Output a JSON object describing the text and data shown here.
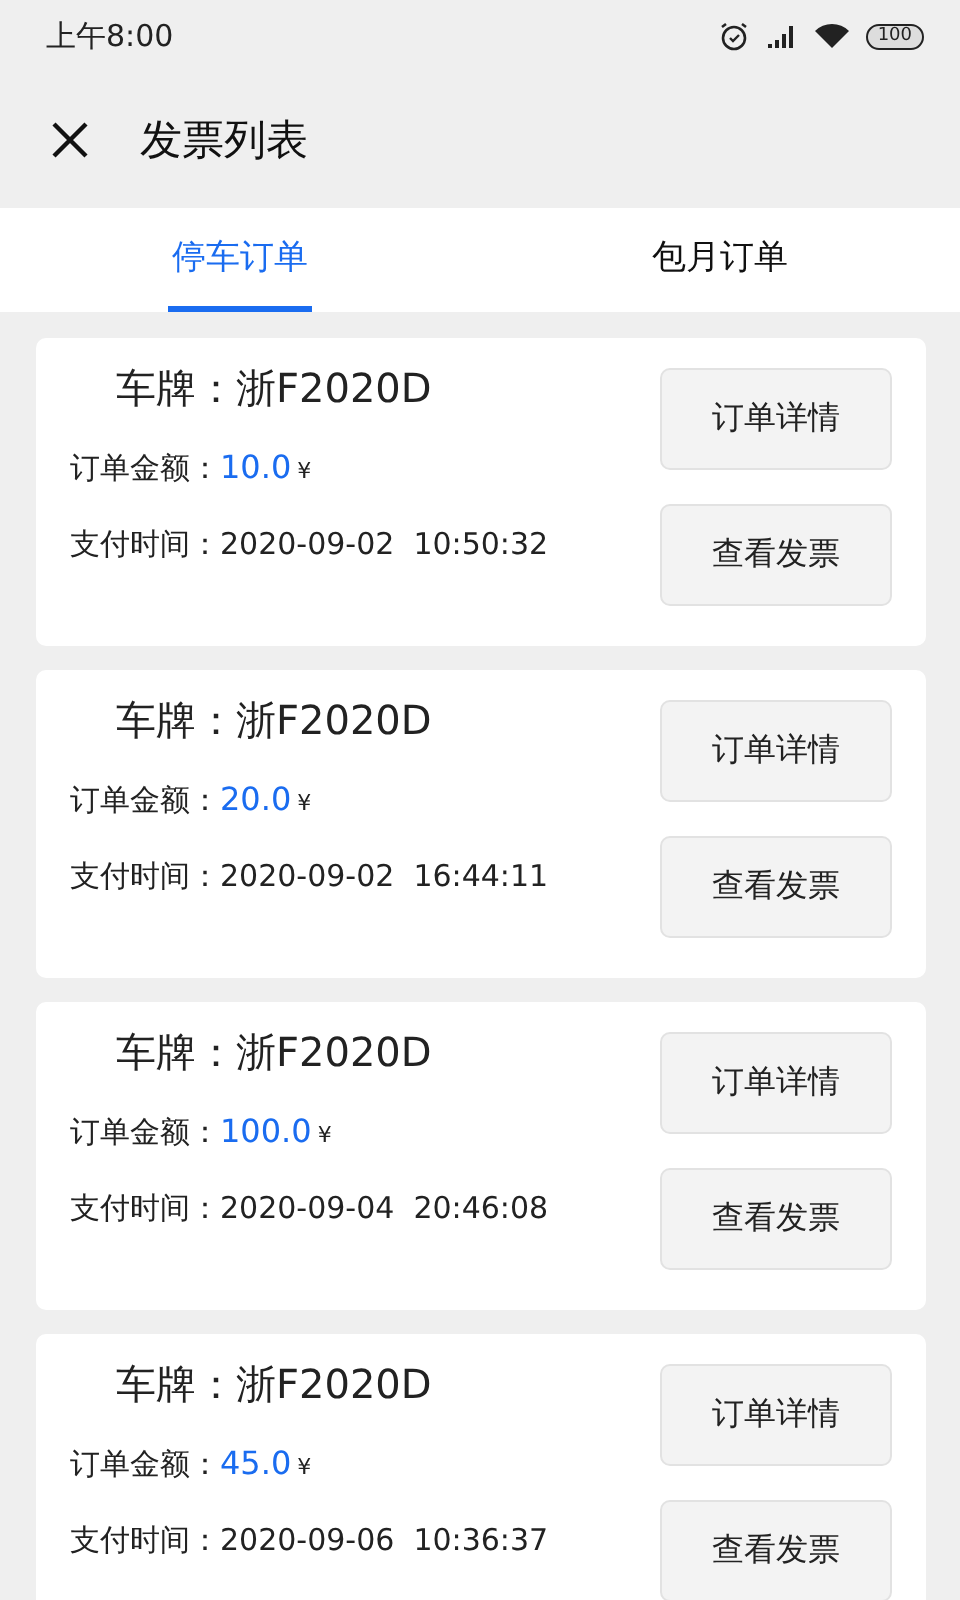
{
  "status_bar": {
    "time": "上午8:00",
    "battery": "100"
  },
  "header": {
    "title": "发票列表"
  },
  "tabs": [
    {
      "label": "停车订单",
      "selected": true
    },
    {
      "label": "包月订单",
      "selected": false
    }
  ],
  "orders": [
    {
      "plate": "车牌：浙F2020D",
      "amount_label": "订单金额：",
      "amount": "10.0",
      "currency": "¥",
      "paid_at": "支付时间：2020-09-02  10:50:32",
      "buttons": [
        "订单详情",
        "查看发票"
      ]
    },
    {
      "plate": "车牌：浙F2020D",
      "amount_label": "订单金额：",
      "amount": "20.0",
      "currency": "¥",
      "paid_at": "支付时间：2020-09-02  16:44:11",
      "buttons": [
        "订单详情",
        "查看发票"
      ]
    },
    {
      "plate": "车牌：浙F2020D",
      "amount_label": "订单金额：",
      "amount": "100.0",
      "currency": "¥",
      "paid_at": "支付时间：2020-09-04  20:46:08",
      "buttons": [
        "订单详情",
        "查看发票"
      ]
    },
    {
      "plate": "车牌：浙F2020D",
      "amount_label": "订单金额：",
      "amount": "45.0",
      "currency": "¥",
      "paid_at": "支付时间：2020-09-06  10:36:37",
      "buttons": [
        "订单详情",
        "查看发票"
      ]
    }
  ]
}
